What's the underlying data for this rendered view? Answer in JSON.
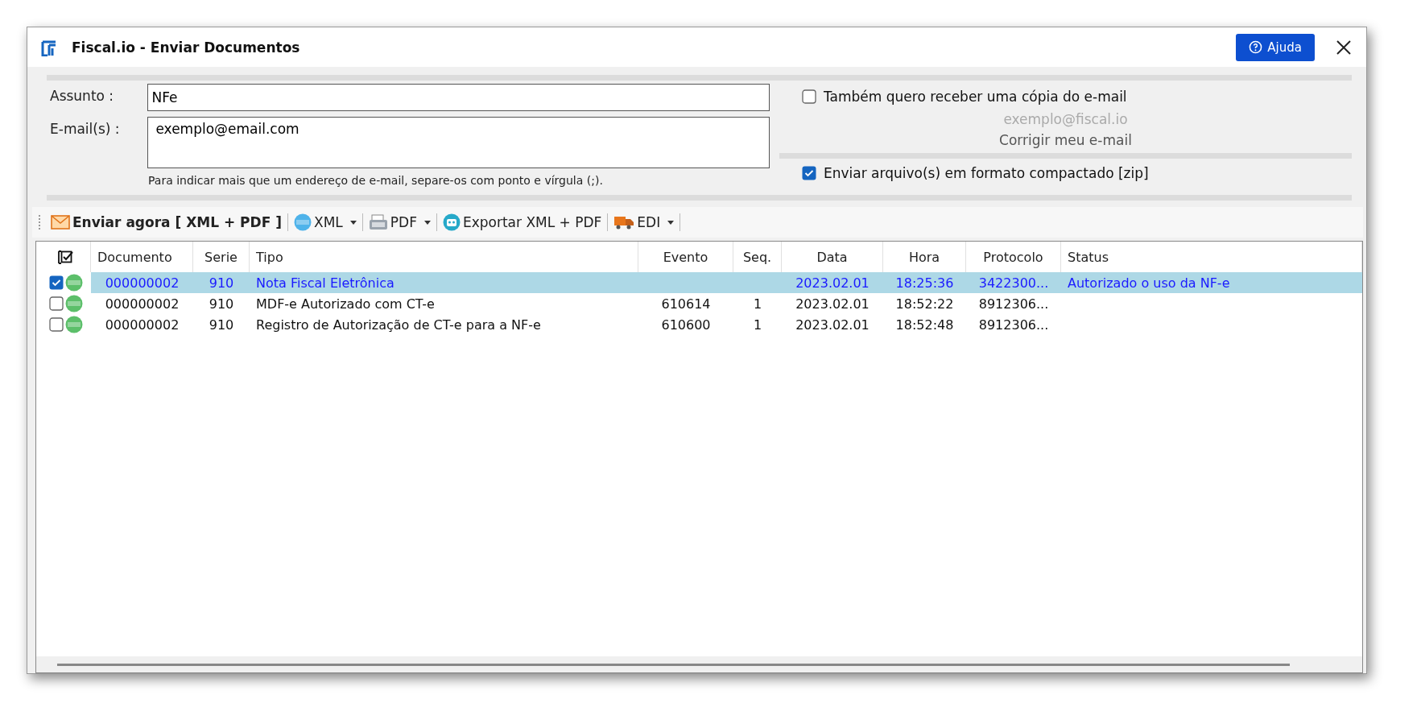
{
  "window": {
    "title": "Fiscal.io - Enviar Documentos",
    "help_button": "Ajuda"
  },
  "form": {
    "subject": {
      "label": "Assunto :",
      "value": "NFe"
    },
    "emails": {
      "label": "E-mail(s) :",
      "value": "exemplo@email.com"
    },
    "hint": "Para indicar mais que um endereço de e-mail, separe-os com ponto e vírgula (;).",
    "copy_option": {
      "label": "Também quero receber uma cópia do e-mail",
      "checked": false
    },
    "sender_email": "exemplo@fiscal.io",
    "fix_email_link": "Corrigir meu e-mail",
    "zip_option": {
      "label": "Enviar arquivo(s) em formato compactado [zip]",
      "checked": true
    }
  },
  "toolbar": [
    {
      "kind": "mail",
      "label": "Enviar agora [ XML + PDF ]",
      "dropdown": false
    },
    {
      "kind": "xml",
      "label": "XML",
      "dropdown": true
    },
    {
      "kind": "pdf",
      "label": "PDF",
      "dropdown": true
    },
    {
      "kind": "export",
      "label": "Exportar XML + PDF",
      "dropdown": false
    },
    {
      "kind": "truck",
      "label": "EDI",
      "dropdown": true
    }
  ],
  "table": {
    "columns": [
      "Documento",
      "Serie",
      "Tipo",
      "Evento",
      "Seq.",
      "Data",
      "Hora",
      "Protocolo",
      "Status"
    ],
    "rows": [
      {
        "checked": true,
        "selected": true,
        "cells": [
          "000000002",
          "910",
          "Nota Fiscal Eletrônica",
          "",
          "",
          "2023.02.01",
          "18:25:36",
          "3422300...",
          "Autorizado o uso da NF-e"
        ]
      },
      {
        "checked": false,
        "selected": false,
        "cells": [
          "000000002",
          "910",
          "MDF-e Autorizado com CT-e",
          "610614",
          "1",
          "2023.02.01",
          "18:52:22",
          "8912306...",
          ""
        ]
      },
      {
        "checked": false,
        "selected": false,
        "cells": [
          "000000002",
          "910",
          "Registro de Autorização de CT-e para a NF-e",
          "610600",
          "1",
          "2023.02.01",
          "18:52:48",
          "8912306...",
          ""
        ]
      }
    ]
  }
}
